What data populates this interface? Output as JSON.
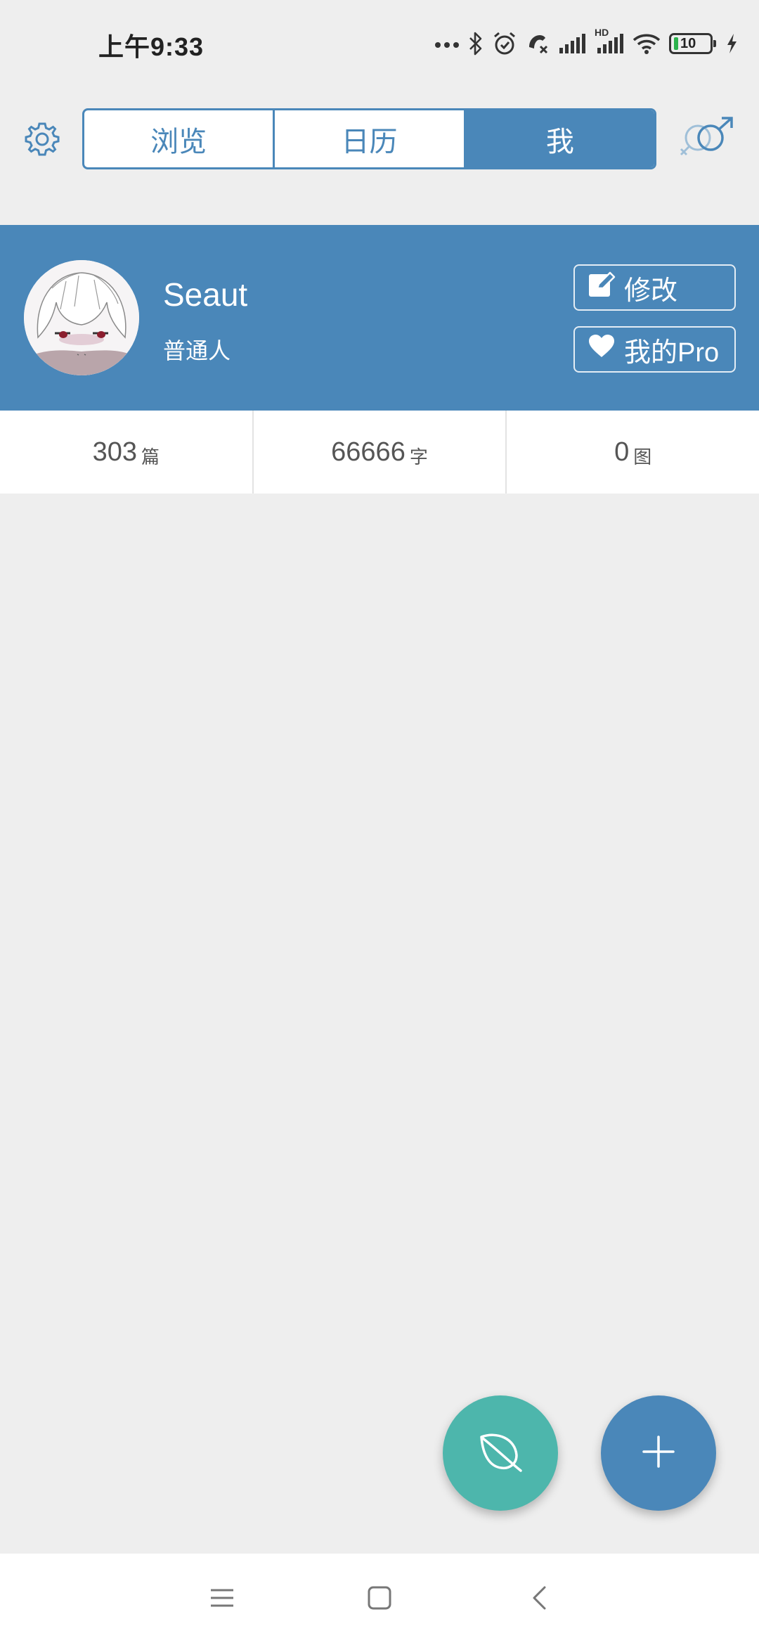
{
  "status_bar": {
    "time": "上午9:33",
    "battery_level": "10",
    "network_label": "HD",
    "icons": [
      "more-dots-icon",
      "bluetooth-icon",
      "alarm-icon",
      "call-muted-icon",
      "signal-icon",
      "signal-hd-icon",
      "wifi-icon",
      "battery-icon",
      "charging-icon"
    ]
  },
  "top_bar": {
    "settings_icon": "gear-icon",
    "tabs": [
      {
        "label": "浏览",
        "active": false
      },
      {
        "label": "日历",
        "active": false
      },
      {
        "label": "我",
        "active": true
      }
    ],
    "gender_icon": "gender-male-icon"
  },
  "profile": {
    "name": "Seaut",
    "role": "普通人",
    "edit_label": "修改",
    "pro_label": "我的Pro",
    "accent_color": "#4a87b9"
  },
  "stats": [
    {
      "value": "303",
      "unit": "篇"
    },
    {
      "value": "66666",
      "unit": "字"
    },
    {
      "value": "0",
      "unit": "图"
    }
  ],
  "fabs": {
    "leaf_icon": "leaf-icon",
    "add_icon": "plus-icon",
    "leaf_color": "#4db6ac",
    "add_color": "#4a87b9"
  },
  "nav_bar": {
    "icons": [
      "menu-icon",
      "home-icon",
      "back-icon"
    ]
  }
}
